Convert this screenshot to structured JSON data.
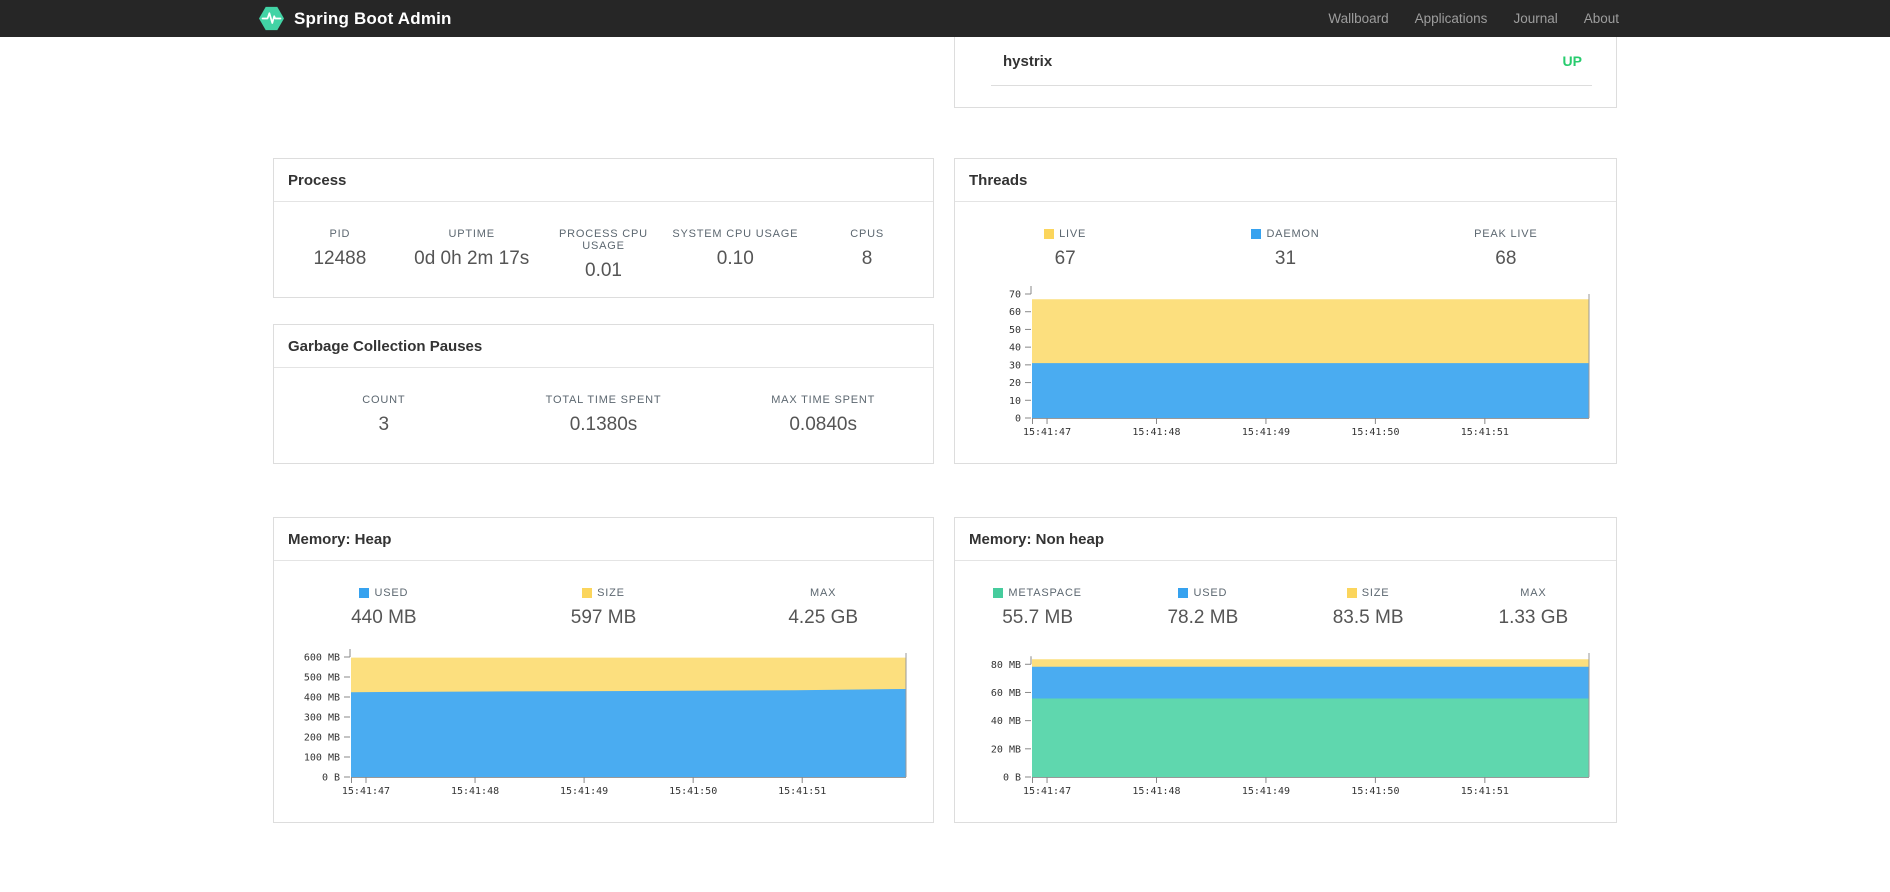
{
  "navbar": {
    "brand": "Spring Boot Admin",
    "links": [
      "Wallboard",
      "Applications",
      "Journal",
      "About"
    ]
  },
  "application": {
    "name": "hystrix",
    "status": "UP",
    "status_color": "#27cc6e"
  },
  "colors": {
    "brand_green": "#42d3a5",
    "navbar_bg": "#262626",
    "chart_yellow": "#fcdf7e",
    "chart_blue": "#4aacf1",
    "chart_green": "#5fd7ae",
    "swatch_yellow": "#fbd55c",
    "swatch_blue": "#36a2ef",
    "swatch_green": "#46cc9d"
  },
  "panels": {
    "process": {
      "title": "Process",
      "metrics": [
        {
          "label": "PID",
          "value": "12488"
        },
        {
          "label": "UPTIME",
          "value": "0d 0h 2m 17s"
        },
        {
          "label": "PROCESS CPU USAGE",
          "value": "0.01"
        },
        {
          "label": "SYSTEM CPU USAGE",
          "value": "0.10"
        },
        {
          "label": "CPUS",
          "value": "8"
        }
      ]
    },
    "gc": {
      "title": "Garbage Collection Pauses",
      "metrics": [
        {
          "label": "COUNT",
          "value": "3"
        },
        {
          "label": "TOTAL TIME SPENT",
          "value": "0.1380s"
        },
        {
          "label": "MAX TIME SPENT",
          "value": "0.0840s"
        }
      ]
    },
    "threads": {
      "title": "Threads",
      "metrics": [
        {
          "label": "LIVE",
          "value": "67",
          "swatch": "#fbd55c"
        },
        {
          "label": "DAEMON",
          "value": "31",
          "swatch": "#36a2ef"
        },
        {
          "label": "PEAK LIVE",
          "value": "68"
        }
      ]
    },
    "heap": {
      "title": "Memory: Heap",
      "metrics": [
        {
          "label": "USED",
          "value": "440 MB",
          "swatch": "#36a2ef"
        },
        {
          "label": "SIZE",
          "value": "597 MB",
          "swatch": "#fbd55c"
        },
        {
          "label": "MAX",
          "value": "4.25 GB"
        }
      ]
    },
    "nonheap": {
      "title": "Memory: Non heap",
      "metrics": [
        {
          "label": "METASPACE",
          "value": "55.7 MB",
          "swatch": "#46cc9d"
        },
        {
          "label": "USED",
          "value": "78.2 MB",
          "swatch": "#36a2ef"
        },
        {
          "label": "SIZE",
          "value": "83.5 MB",
          "swatch": "#fbd55c"
        },
        {
          "label": "MAX",
          "value": "1.33 GB"
        }
      ]
    }
  },
  "chart_data": [
    {
      "id": "threads-chart",
      "type": "area",
      "title": "Threads",
      "x_labels": [
        "15:41:47",
        "15:41:48",
        "15:41:49",
        "15:41:50",
        "15:41:51"
      ],
      "ylim": [
        0,
        70
      ],
      "grid": false,
      "legend_position": "top-stats",
      "yticks": [
        {
          "v": 0,
          "label": "0"
        },
        {
          "v": 10,
          "label": "10"
        },
        {
          "v": 20,
          "label": "20"
        },
        {
          "v": 30,
          "label": "30"
        },
        {
          "v": 40,
          "label": "40"
        },
        {
          "v": 50,
          "label": "50"
        },
        {
          "v": 60,
          "label": "60"
        },
        {
          "v": 70,
          "label": "70"
        }
      ],
      "series": [
        {
          "name": "LIVE",
          "color": "#fcdf7e",
          "values": [
            67,
            67,
            67,
            67,
            67,
            67
          ]
        },
        {
          "name": "DAEMON",
          "color": "#4aacf1",
          "values": [
            31,
            31,
            31,
            31,
            31,
            31
          ]
        }
      ]
    },
    {
      "id": "heap-chart",
      "type": "area",
      "title": "Memory: Heap",
      "x_labels": [
        "15:41:47",
        "15:41:48",
        "15:41:49",
        "15:41:50",
        "15:41:51"
      ],
      "ylim": [
        0,
        620
      ],
      "grid": false,
      "legend_position": "top-stats",
      "yticks": [
        {
          "v": 0,
          "label": "0 B"
        },
        {
          "v": 100,
          "label": "100 MB"
        },
        {
          "v": 200,
          "label": "200 MB"
        },
        {
          "v": 300,
          "label": "300 MB"
        },
        {
          "v": 400,
          "label": "400 MB"
        },
        {
          "v": 500,
          "label": "500 MB"
        },
        {
          "v": 600,
          "label": "600 MB"
        }
      ],
      "series": [
        {
          "name": "SIZE",
          "color": "#fcdf7e",
          "values": [
            597,
            597,
            597,
            597,
            597,
            597
          ]
        },
        {
          "name": "USED",
          "color": "#4aacf1",
          "values": [
            424,
            427,
            429,
            431,
            434,
            440
          ]
        }
      ]
    },
    {
      "id": "nonheap-chart",
      "type": "area",
      "title": "Memory: Non heap",
      "x_labels": [
        "15:41:47",
        "15:41:48",
        "15:41:49",
        "15:41:50",
        "15:41:51"
      ],
      "ylim": [
        0,
        88
      ],
      "grid": false,
      "legend_position": "top-stats",
      "yticks": [
        {
          "v": 0,
          "label": "0 B"
        },
        {
          "v": 20,
          "label": "20 MB"
        },
        {
          "v": 40,
          "label": "40 MB"
        },
        {
          "v": 60,
          "label": "60 MB"
        },
        {
          "v": 80,
          "label": "80 MB"
        }
      ],
      "series": [
        {
          "name": "SIZE",
          "color": "#fcdf7e",
          "values": [
            83.5,
            83.5,
            83.5,
            83.5,
            83.5,
            83.5
          ]
        },
        {
          "name": "USED",
          "color": "#4aacf1",
          "values": [
            78.2,
            78.2,
            78.2,
            78.2,
            78.2,
            78.2
          ]
        },
        {
          "name": "METASPACE",
          "color": "#5fd7ae",
          "values": [
            55.7,
            55.7,
            55.7,
            55.7,
            55.7,
            55.7
          ]
        }
      ]
    }
  ]
}
